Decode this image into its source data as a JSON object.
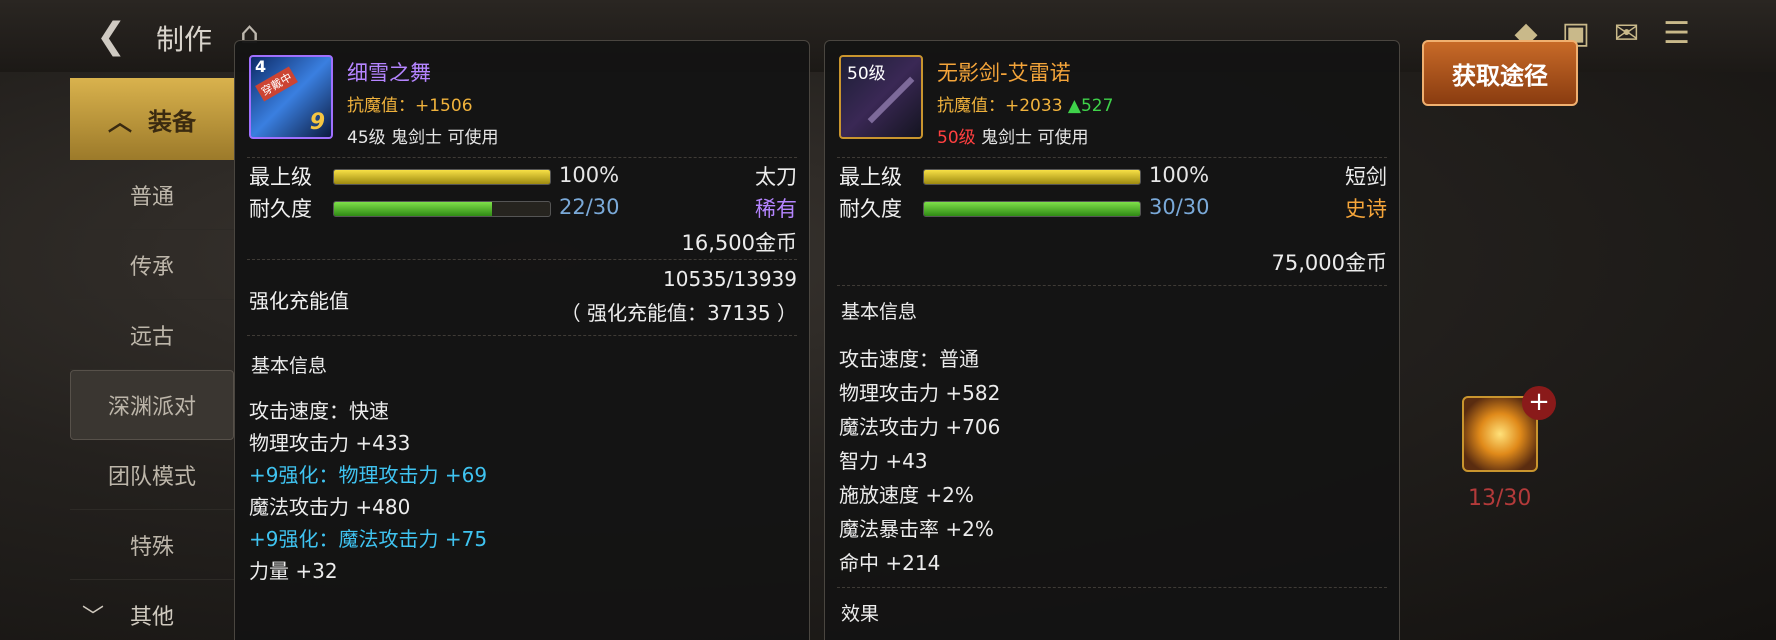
{
  "header": {
    "back_icon": "arrow-left-icon",
    "title": "制作",
    "home_icon": "home-icon",
    "icons": [
      "gem-icon",
      "bag-icon",
      "mail-icon",
      "chat-icon"
    ]
  },
  "sidebar": {
    "head": "装备",
    "items": [
      "普通",
      "传承",
      "远古",
      "深渊派对",
      "团队模式",
      "特殊"
    ],
    "active_index": 3,
    "other": "其他"
  },
  "button": {
    "label": "获取途径"
  },
  "item1": {
    "icon_level": "4",
    "icon_badge": "穿戴中",
    "icon_plus": "9",
    "name": "细雪之舞",
    "resist": "抗魔值：+1506",
    "usable_level": "45级",
    "usable_class": "鬼剑士 可使用",
    "grade_label": "最上级",
    "grade_pct": "100%",
    "grade_fraction": 1.0,
    "weapon_type": "太刀",
    "dur_label": "耐久度",
    "durability": "22/30",
    "dur_fraction": 0.733,
    "rarity": "稀有",
    "price": "16,500金币",
    "enhance_label": "强化充能值",
    "enhance_value": "10535/13939",
    "enhance_total": "（ 强化充能值：37135 ）",
    "basic_info": "基本信息",
    "stats": [
      {
        "text": "攻击速度：快速",
        "style": "normal"
      },
      {
        "text": "物理攻击力 +433",
        "style": "normal"
      },
      {
        "text": "+9强化：物理攻击力 +69",
        "style": "cyan"
      },
      {
        "text": "魔法攻击力 +480",
        "style": "normal"
      },
      {
        "text": "+9强化：魔法攻击力 +75",
        "style": "cyan"
      },
      {
        "text": "力量 +32",
        "style": "normal"
      }
    ]
  },
  "item2": {
    "icon_level": "50级",
    "name": "无影剑-艾雷诺",
    "resist": "抗魔值：+2033",
    "resist_up": "▲527",
    "usable_level": "50级",
    "usable_class": "鬼剑士 可使用",
    "grade_label": "最上级",
    "grade_pct": "100%",
    "grade_fraction": 1.0,
    "weapon_type": "短剑",
    "dur_label": "耐久度",
    "durability": "30/30",
    "dur_fraction": 1.0,
    "rarity": "史诗",
    "price": "75,000金币",
    "basic_info": "基本信息",
    "stats": [
      {
        "text": "攻击速度：普通",
        "style": "normal"
      },
      {
        "text": "物理攻击力 +582",
        "style": "normal"
      },
      {
        "text": "魔法攻击力 +706",
        "style": "normal"
      },
      {
        "text": "智力 +43",
        "style": "normal"
      },
      {
        "text": "施放速度 +2%",
        "style": "normal"
      },
      {
        "text": "魔法暴击率 +2%",
        "style": "normal"
      },
      {
        "text": "命中 +214",
        "style": "normal"
      }
    ],
    "effect_label": "效果"
  },
  "gem": {
    "count": "13/30"
  },
  "colors": {
    "rare": "#b585ff",
    "epic": "#f5a53a",
    "cyan": "#3fc3f0",
    "gold": "#f0b23c"
  }
}
